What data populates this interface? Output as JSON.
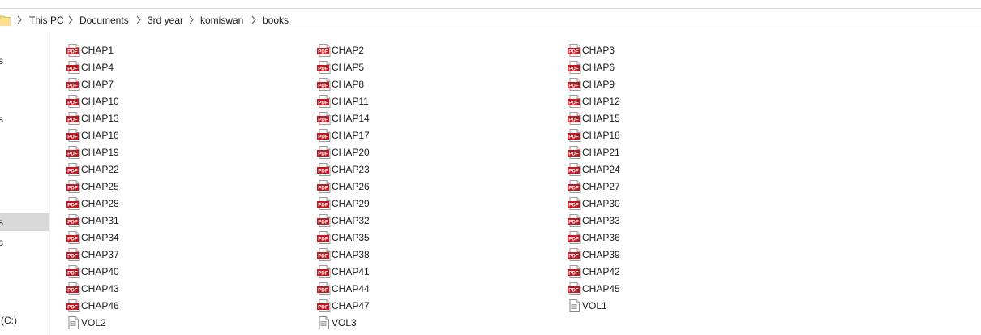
{
  "breadcrumb": [
    "This PC",
    "Documents",
    "3rd year",
    "komiswan",
    "books"
  ],
  "nav": {
    "items": [
      {
        "label": "s",
        "selected": false
      },
      {
        "label": "s",
        "selected": false
      },
      {
        "label": "s",
        "selected": true
      },
      {
        "label": "s",
        "selected": false
      },
      {
        "label": "(C:)",
        "selected": false
      }
    ]
  },
  "files": {
    "columns": [
      [
        {
          "name": "CHAP1",
          "type": "pdf"
        },
        {
          "name": "CHAP4",
          "type": "pdf"
        },
        {
          "name": "CHAP7",
          "type": "pdf"
        },
        {
          "name": "CHAP10",
          "type": "pdf"
        },
        {
          "name": "CHAP13",
          "type": "pdf"
        },
        {
          "name": "CHAP16",
          "type": "pdf"
        },
        {
          "name": "CHAP19",
          "type": "pdf"
        },
        {
          "name": "CHAP22",
          "type": "pdf"
        },
        {
          "name": "CHAP25",
          "type": "pdf"
        },
        {
          "name": "CHAP28",
          "type": "pdf"
        },
        {
          "name": "CHAP31",
          "type": "pdf"
        },
        {
          "name": "CHAP34",
          "type": "pdf"
        },
        {
          "name": "CHAP37",
          "type": "pdf"
        },
        {
          "name": "CHAP40",
          "type": "pdf"
        },
        {
          "name": "CHAP43",
          "type": "pdf"
        },
        {
          "name": "CHAP46",
          "type": "pdf"
        },
        {
          "name": "VOL2",
          "type": "doc"
        }
      ],
      [
        {
          "name": "CHAP2",
          "type": "pdf"
        },
        {
          "name": "CHAP5",
          "type": "pdf"
        },
        {
          "name": "CHAP8",
          "type": "pdf"
        },
        {
          "name": "CHAP11",
          "type": "pdf"
        },
        {
          "name": "CHAP14",
          "type": "pdf"
        },
        {
          "name": "CHAP17",
          "type": "pdf"
        },
        {
          "name": "CHAP20",
          "type": "pdf"
        },
        {
          "name": "CHAP23",
          "type": "pdf"
        },
        {
          "name": "CHAP26",
          "type": "pdf"
        },
        {
          "name": "CHAP29",
          "type": "pdf"
        },
        {
          "name": "CHAP32",
          "type": "pdf"
        },
        {
          "name": "CHAP35",
          "type": "pdf"
        },
        {
          "name": "CHAP38",
          "type": "pdf"
        },
        {
          "name": "CHAP41",
          "type": "pdf"
        },
        {
          "name": "CHAP44",
          "type": "pdf"
        },
        {
          "name": "CHAP47",
          "type": "pdf"
        },
        {
          "name": "VOL3",
          "type": "doc"
        }
      ],
      [
        {
          "name": "CHAP3",
          "type": "pdf"
        },
        {
          "name": "CHAP6",
          "type": "pdf"
        },
        {
          "name": "CHAP9",
          "type": "pdf"
        },
        {
          "name": "CHAP12",
          "type": "pdf"
        },
        {
          "name": "CHAP15",
          "type": "pdf"
        },
        {
          "name": "CHAP18",
          "type": "pdf"
        },
        {
          "name": "CHAP21",
          "type": "pdf"
        },
        {
          "name": "CHAP24",
          "type": "pdf"
        },
        {
          "name": "CHAP27",
          "type": "pdf"
        },
        {
          "name": "CHAP30",
          "type": "pdf"
        },
        {
          "name": "CHAP33",
          "type": "pdf"
        },
        {
          "name": "CHAP36",
          "type": "pdf"
        },
        {
          "name": "CHAP39",
          "type": "pdf"
        },
        {
          "name": "CHAP42",
          "type": "pdf"
        },
        {
          "name": "CHAP45",
          "type": "pdf"
        },
        {
          "name": "VOL1",
          "type": "doc"
        }
      ]
    ]
  },
  "colors": {
    "pdf_red": "#c4161c",
    "folder_yellow": "#f8d775",
    "selected_bg": "#d9d9d9"
  }
}
